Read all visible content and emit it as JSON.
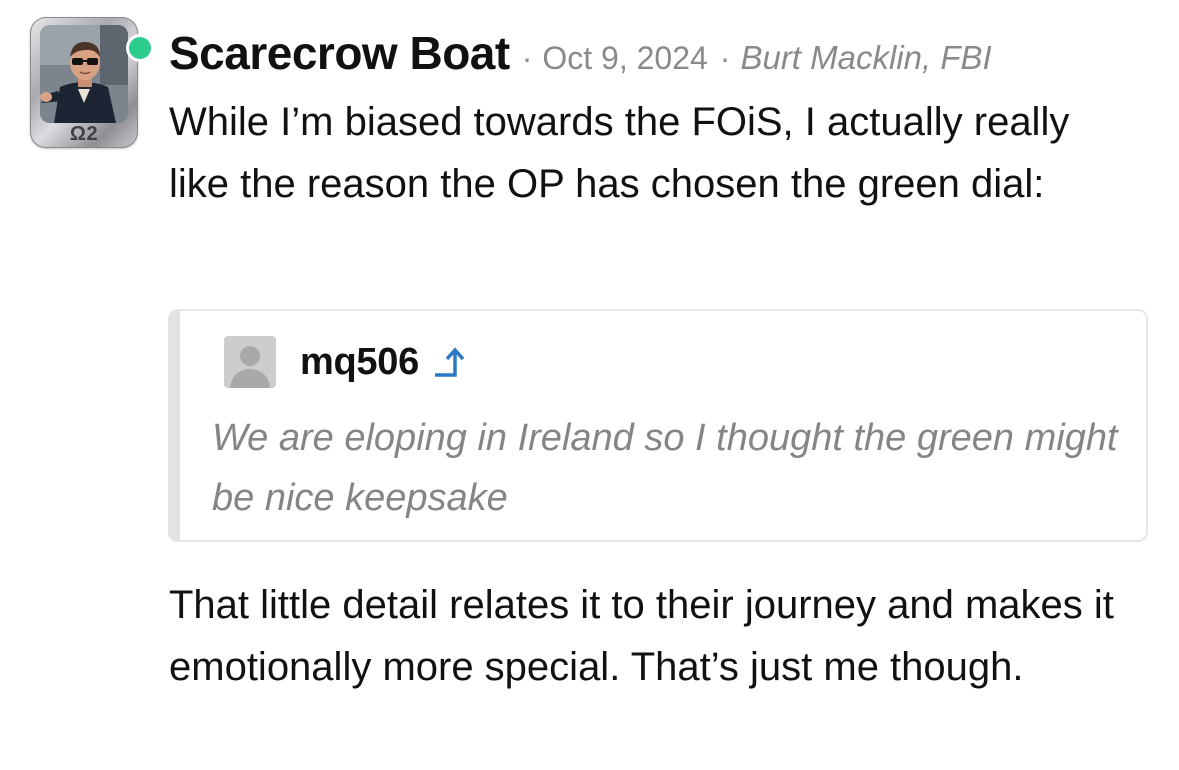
{
  "post": {
    "avatar": {
      "icon": "user-photo-avatar",
      "badge": "Ω2",
      "online": true,
      "online_color": "#2ecc8f"
    },
    "username": "Scarecrow Boat",
    "date": "Oct 9, 2024",
    "user_title": "Burt Macklin, FBI",
    "separator": "·",
    "text_before_quote": "While I’m biased towards the FOiS, I actually really like the reason the OP has chosen the green dial:",
    "quote": {
      "avatar_icon": "default-user-avatar",
      "username": "mq506",
      "jump_icon": "arrow-up-jump-icon",
      "text": "We are eloping in Ireland so I thought the green might be nice keepsake"
    },
    "text_after_quote": "That little detail relates it to their journey and makes it emotionally more special. That’s just me though."
  },
  "colors": {
    "text": "#111111",
    "meta": "#8a8a8a",
    "quote_text": "#858585",
    "quote_border": "#e3e3e3",
    "jump_arrow": "#2b78c4"
  }
}
